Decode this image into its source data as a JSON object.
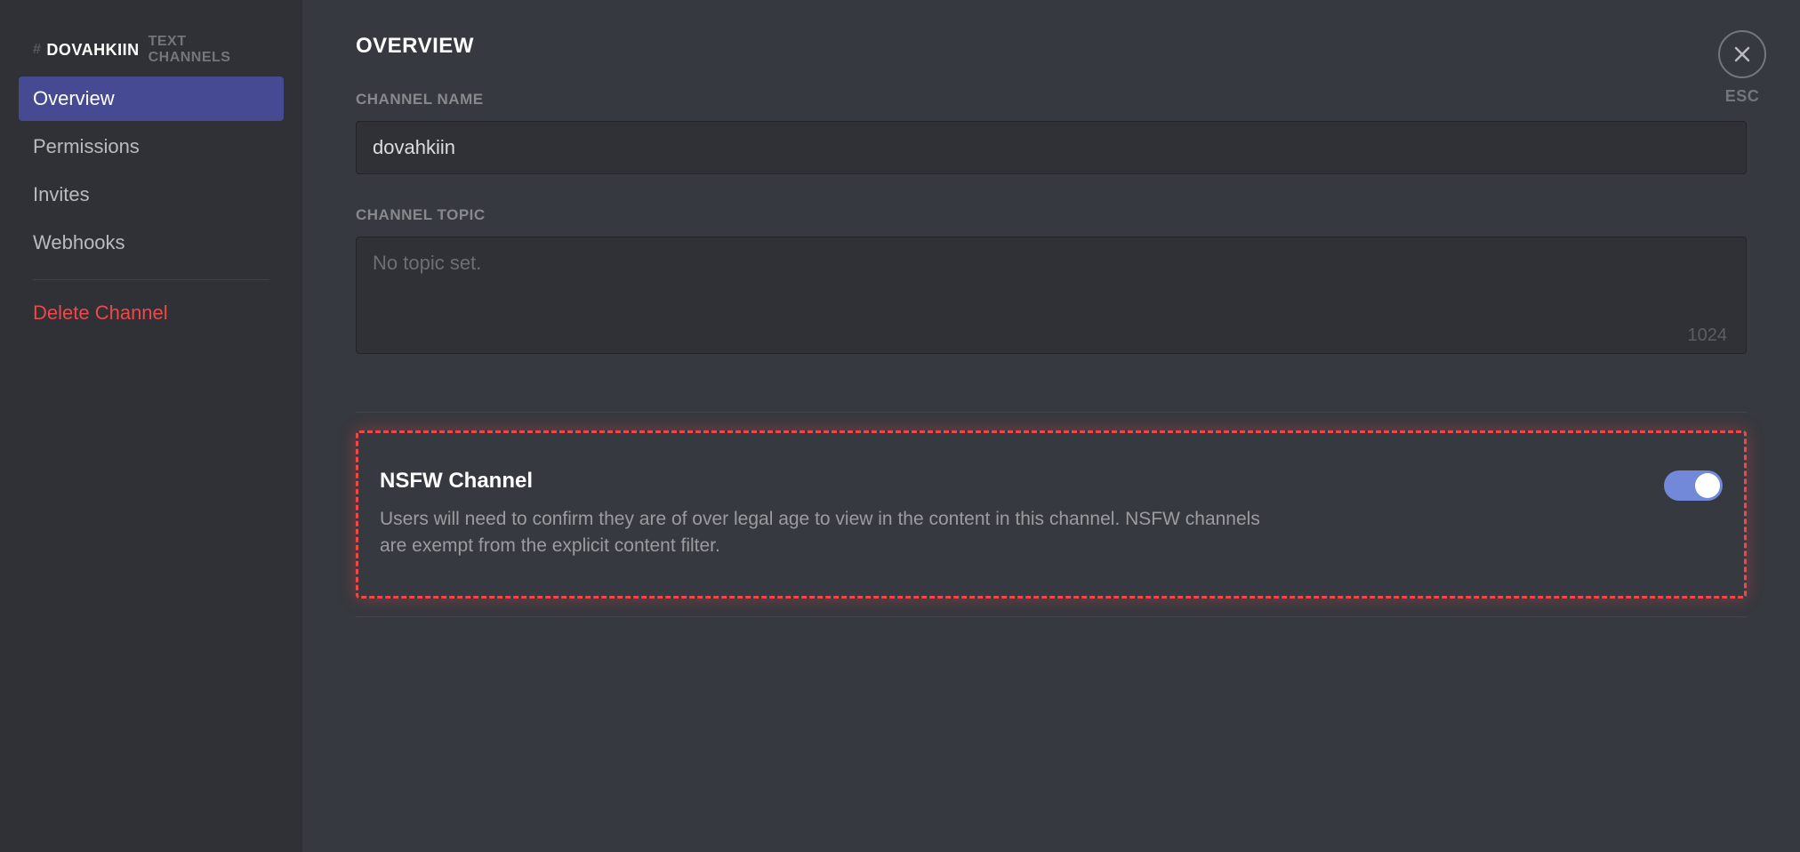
{
  "sidebar": {
    "channel_name": "DOVAHKIIN",
    "channel_type": "TEXT CHANNELS",
    "items": [
      {
        "label": "Overview",
        "active": true
      },
      {
        "label": "Permissions",
        "active": false
      },
      {
        "label": "Invites",
        "active": false
      },
      {
        "label": "Webhooks",
        "active": false
      }
    ],
    "delete_label": "Delete Channel"
  },
  "main": {
    "title": "OVERVIEW",
    "channel_name_label": "CHANNEL NAME",
    "channel_name_value": "dovahkiin",
    "channel_topic_label": "CHANNEL TOPIC",
    "channel_topic_placeholder": "No topic set.",
    "channel_topic_max": "1024",
    "nsfw": {
      "title": "NSFW Channel",
      "description": "Users will need to confirm they are of over legal age to view in the content in this channel. NSFW channels are exempt from the explicit content filter.",
      "enabled": true
    }
  },
  "close": {
    "esc_label": "ESC"
  }
}
